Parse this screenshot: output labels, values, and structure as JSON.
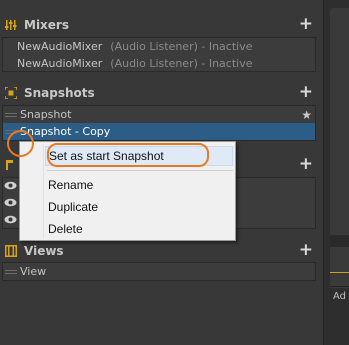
{
  "mixers": {
    "title": "Mixers",
    "add_label": "+",
    "items": [
      {
        "name": "NewAudioMixer",
        "detail": "(Audio Listener) - Inactive"
      },
      {
        "name": "NewAudioMixer",
        "detail": "(Audio Listener) - Inactive"
      }
    ]
  },
  "snapshots": {
    "title": "Snapshots",
    "add_label": "+",
    "star": "★",
    "items": [
      {
        "name": "Snapshot"
      },
      {
        "name": "Snapshot - Copy"
      }
    ]
  },
  "groups": {
    "add_label": "+",
    "eye_glyph": "👁"
  },
  "views": {
    "title": "Views",
    "add_label": "+",
    "items": [
      {
        "name": "View"
      }
    ]
  },
  "context_menu": {
    "items": [
      {
        "label": "Set as start Snapshot"
      },
      {
        "label": "Rename"
      },
      {
        "label": "Duplicate"
      },
      {
        "label": "Delete"
      }
    ]
  },
  "right_panel": {
    "text": "Ad"
  },
  "colors": {
    "selection": "#2c5d87",
    "annotation": "#e97a24",
    "icon_accent": "#d9a21b"
  },
  "icons": [
    "mixer-icon",
    "snapshot-icon",
    "group-icon",
    "views-icon",
    "eye-icon",
    "star-icon",
    "plus-icon"
  ]
}
